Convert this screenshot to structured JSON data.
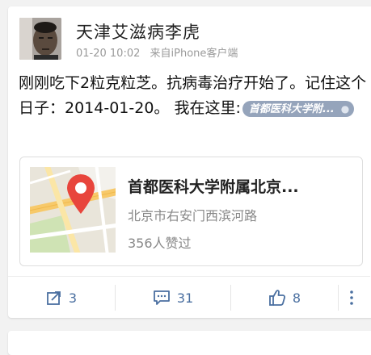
{
  "post": {
    "username": "天津艾滋病李虎",
    "time": "01-20 10:02",
    "source": "来自iPhone客户端",
    "text": "刚刚吃下2粒克粒芝。抗病毒治疗开始了。记住这个日子：2014-01-20。 我在这里:",
    "location_tag": "首都医科大学附...",
    "map_card": {
      "title": "首都医科大学附属北京...",
      "address": "北京市右安门西滨河路",
      "likes": "356人赞过"
    },
    "actions": {
      "repost_count": "3",
      "comment_count": "31",
      "like_count": "8"
    }
  },
  "colors": {
    "accent": "#4a6fa0",
    "tag_bg": "#95a4bb",
    "pin": "#e8453c"
  },
  "icons": [
    "repost-icon",
    "comment-icon",
    "thumbs-up-icon",
    "more-icon",
    "location-pin-icon",
    "map-pin-icon"
  ]
}
